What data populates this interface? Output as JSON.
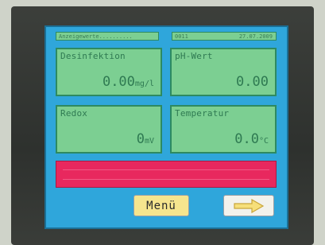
{
  "status_bar": {
    "left_text": "Anzeigewerte..........",
    "right_left_text": "0011",
    "right_text": "27.07.2009"
  },
  "panels": [
    {
      "label": "Desinfektion",
      "value": "0.00",
      "unit": "mg/l"
    },
    {
      "label": "pH-Wert",
      "value": "0.00",
      "unit": ""
    },
    {
      "label": "Redox",
      "value": "0",
      "unit": "mV"
    },
    {
      "label": "Temperatur",
      "value": "0.0",
      "unit": "°C"
    }
  ],
  "buttons": {
    "menu_label": "Menü",
    "next_icon": "right-arrow-icon"
  },
  "colors": {
    "screen_bg": "#2fa6db",
    "panel_bg": "#7ccf92",
    "alarm_bar": "#e8285e",
    "menu_button": "#f6e58e"
  }
}
